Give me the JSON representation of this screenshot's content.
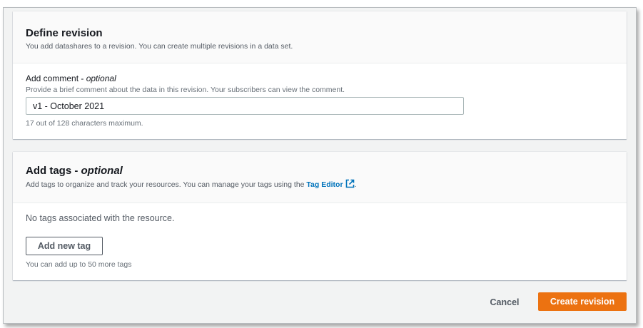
{
  "revision": {
    "title": "Define revision",
    "description": "You add datashares to a revision. You can create multiple revisions in a data set.",
    "comment_label": "Add comment - ",
    "comment_optional": "optional",
    "comment_help": "Provide a brief comment about the data in this revision. Your subscribers can view the comment.",
    "comment_value": "v1 - October 2021",
    "comment_constraint": "17 out of 128 characters maximum."
  },
  "tags": {
    "title": "Add tags - ",
    "title_optional": "optional",
    "description_prefix": "Add tags to organize and track your resources. You can manage your tags using the ",
    "tag_editor_link": "Tag Editor",
    "description_suffix": ".",
    "empty_text": "No tags associated with the resource.",
    "add_button": "Add new tag",
    "limit_text": "You can add up to 50 more tags"
  },
  "actions": {
    "cancel": "Cancel",
    "create": "Create revision"
  },
  "colors": {
    "primary": "#ec7211",
    "link": "#0073bb",
    "background": "#f2f3f3"
  },
  "icons": {
    "external_link": "external-link-icon"
  }
}
